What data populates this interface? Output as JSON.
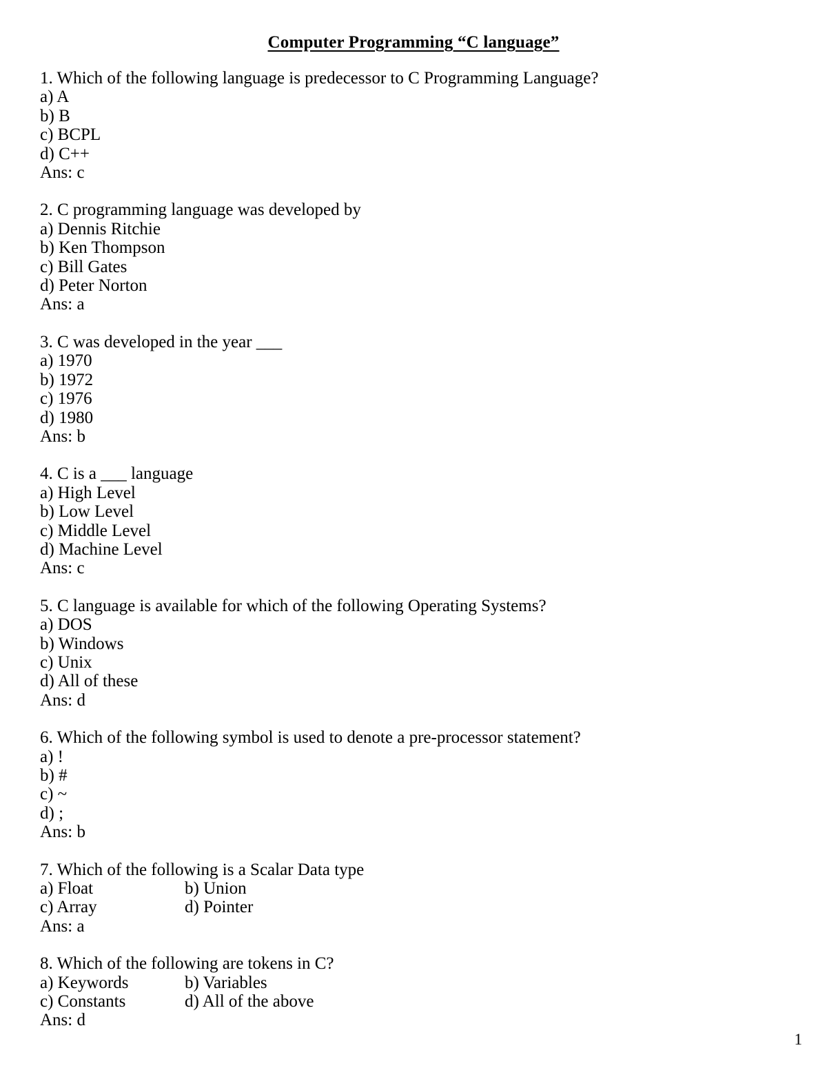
{
  "document": {
    "title": "Computer Programming “C language”",
    "page_number": "1"
  },
  "questions": [
    {
      "number": "1.",
      "text": "1. Which of the following language is predecessor to C Programming Language?",
      "layout": "single",
      "options": [
        {
          "label": "a) A"
        },
        {
          "label": "b) B"
        },
        {
          "label": "c) BCPL"
        },
        {
          "label": "d) C++"
        }
      ],
      "answer": "Ans: c"
    },
    {
      "number": "2.",
      "text": "2. C programming language was developed by",
      "layout": "single",
      "options": [
        {
          "label": "a) Dennis Ritchie"
        },
        {
          "label": "b) Ken Thompson"
        },
        {
          "label": "c) Bill Gates"
        },
        {
          "label": "d) Peter Norton"
        }
      ],
      "answer": "Ans: a"
    },
    {
      "number": "3.",
      "text": "3. C was developed in the year ___",
      "layout": "single",
      "options": [
        {
          "label": "a) 1970"
        },
        {
          "label": "b) 1972"
        },
        {
          "label": "c) 1976"
        },
        {
          "label": "d) 1980"
        }
      ],
      "answer": "Ans: b"
    },
    {
      "number": "4.",
      "text": "4. C is a ___ language",
      "layout": "single",
      "options": [
        {
          "label": "a) High Level"
        },
        {
          "label": "b) Low Level"
        },
        {
          "label": "c) Middle Level"
        },
        {
          "label": "d) Machine Level"
        }
      ],
      "answer": "Ans: c"
    },
    {
      "number": "5.",
      "text": "5. C language is available for which of the following Operating Systems?",
      "layout": "single",
      "options": [
        {
          "label": "a) DOS"
        },
        {
          "label": "b) Windows"
        },
        {
          "label": "c) Unix"
        },
        {
          "label": "d) All of these"
        }
      ],
      "answer": "Ans: d"
    },
    {
      "number": "6.",
      "text": "6. Which of the following symbol is used to denote a pre-processor statement?",
      "layout": "single",
      "options": [
        {
          "label": "a) !"
        },
        {
          "label": "b) #"
        },
        {
          "label": "c) ~"
        },
        {
          "label": "d) ;"
        }
      ],
      "answer": "Ans: b"
    },
    {
      "number": "7.",
      "text": "7. Which of the following is a Scalar Data type",
      "layout": "two-column",
      "options": [
        {
          "label": "a) Float"
        },
        {
          "label": "b) Union"
        },
        {
          "label": "c) Array"
        },
        {
          "label": "d) Pointer"
        }
      ],
      "answer": "Ans: a"
    },
    {
      "number": "8.",
      "text": "8. Which of the following are tokens in C?",
      "layout": "two-column",
      "options": [
        {
          "label": "a) Keywords"
        },
        {
          "label": "b) Variables"
        },
        {
          "label": "c) Constants"
        },
        {
          "label": "d) All of the above"
        }
      ],
      "answer": "Ans: d"
    }
  ]
}
